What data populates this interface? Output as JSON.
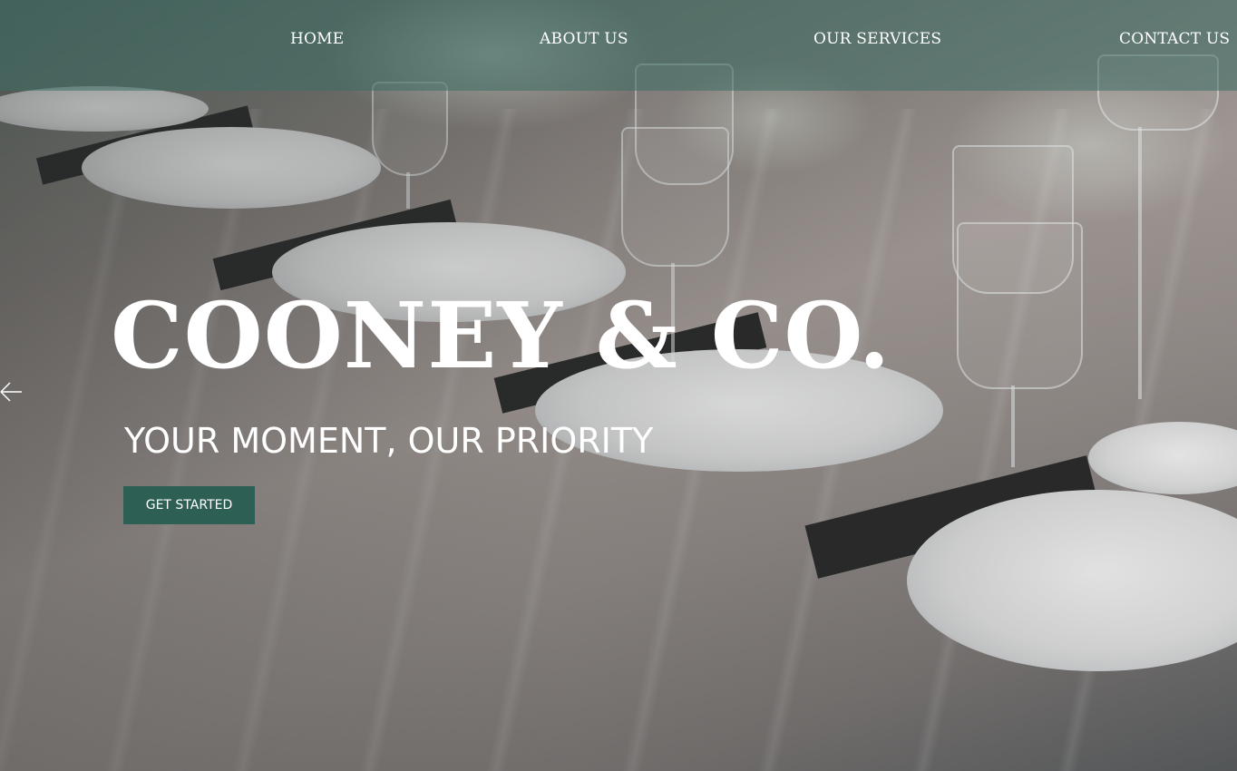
{
  "nav": {
    "items": [
      {
        "label": "HOME"
      },
      {
        "label": "ABOUT US"
      },
      {
        "label": "OUR SERVICES"
      },
      {
        "label": "CONTACT US"
      }
    ]
  },
  "hero": {
    "title": "COONEY & CO.",
    "tagline": "YOUR MOMENT, OUR PRIORITY",
    "cta_label": "GET STARTED",
    "prev_icon": "arrow-left-icon"
  },
  "colors": {
    "nav_overlay": "#3c6e64",
    "cta_background": "#2e5f55",
    "text": "#ffffff"
  }
}
